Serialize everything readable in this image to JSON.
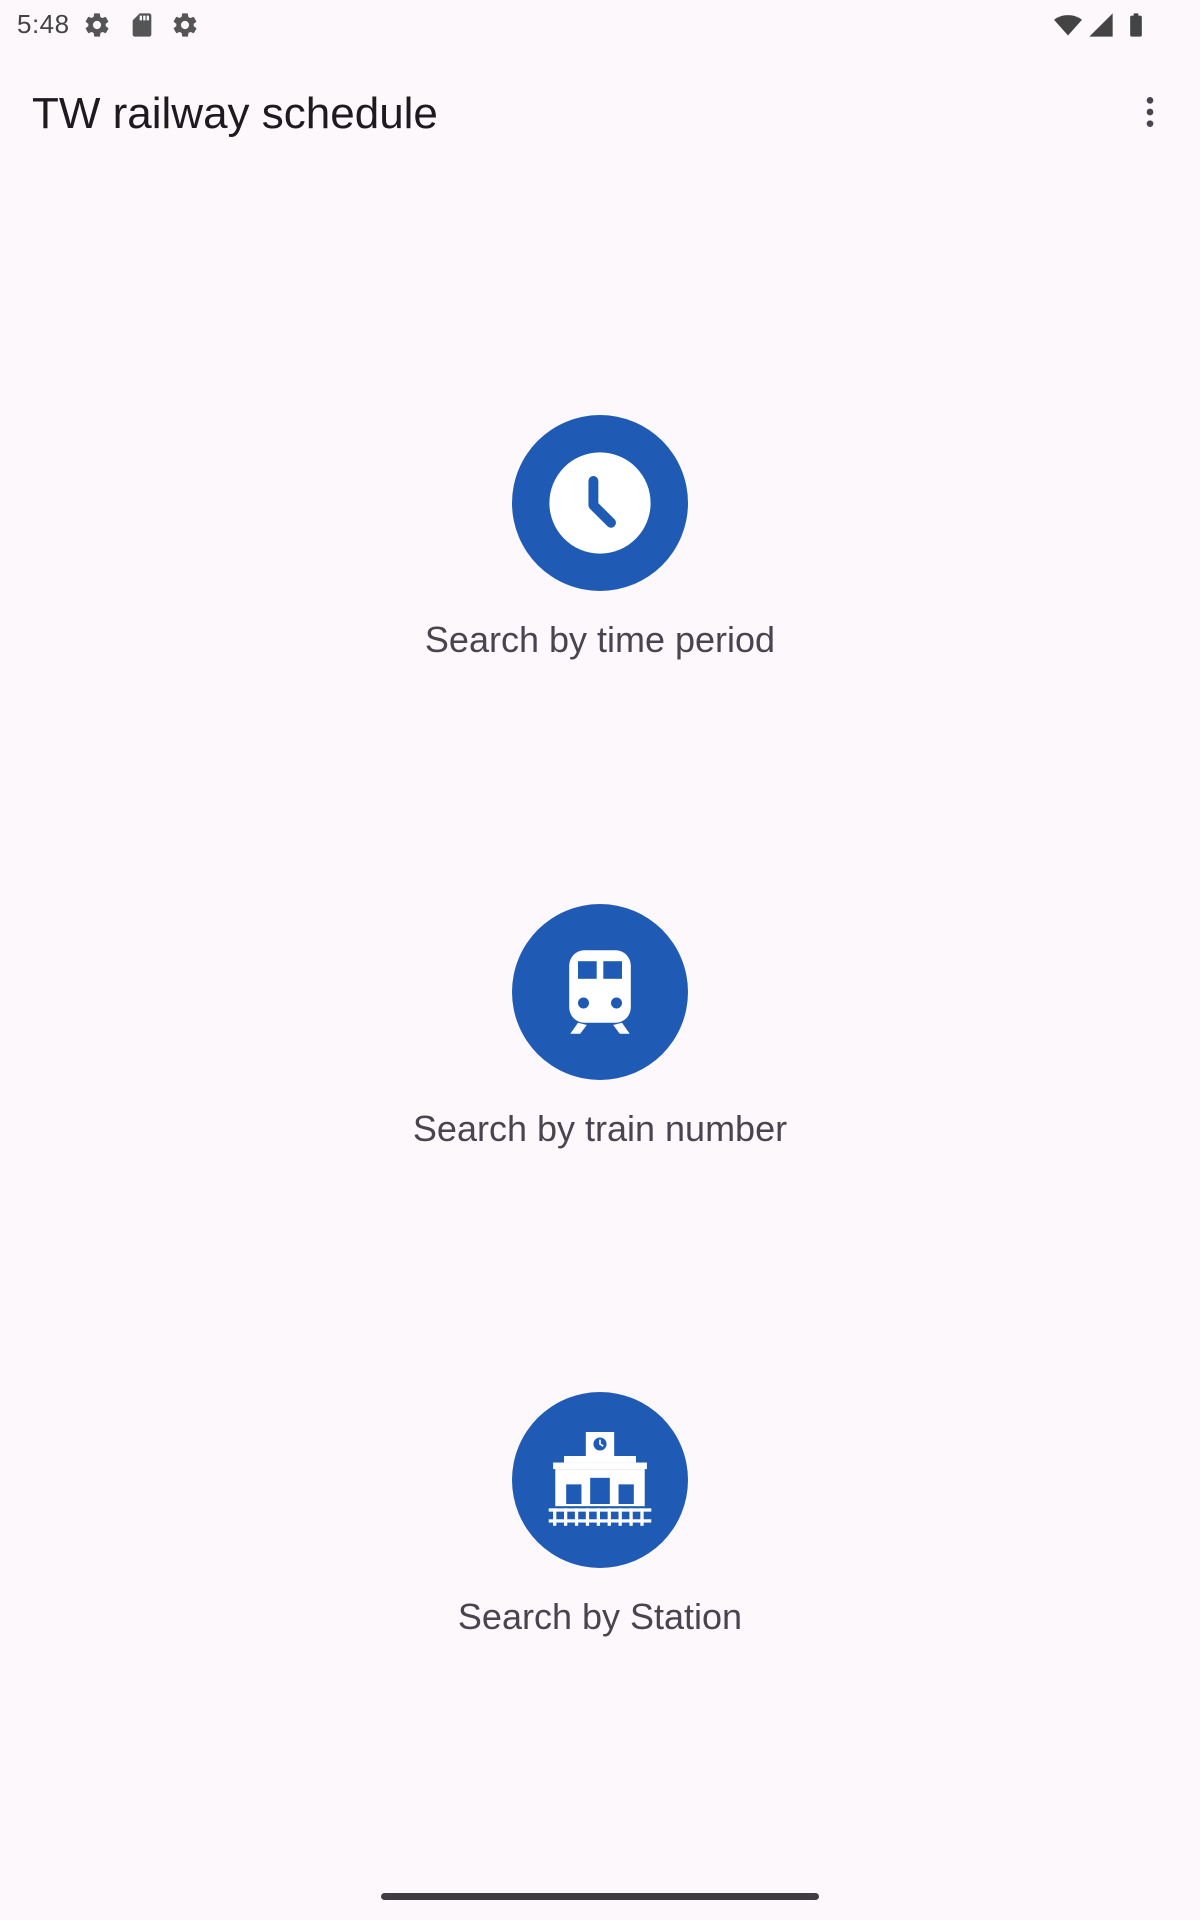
{
  "status_bar": {
    "time": "5:48",
    "left_icons": [
      "settings-gear-icon",
      "sd-card-icon",
      "settings-gear-icon"
    ],
    "right_icons": [
      "wifi-icon",
      "cellular-signal-icon",
      "battery-icon"
    ]
  },
  "app_bar": {
    "title": "TW railway schedule",
    "overflow_icon": "more-vert-icon"
  },
  "options": [
    {
      "label": "Search by time period",
      "icon": "clock-icon"
    },
    {
      "label": "Search by train number",
      "icon": "train-icon"
    },
    {
      "label": "Search by Station",
      "icon": "station-icon"
    }
  ],
  "colors": {
    "background": "#fdf8fc",
    "accent": "#1f5bb5",
    "label_text": "#49454f",
    "title_text": "#1d1b20"
  }
}
